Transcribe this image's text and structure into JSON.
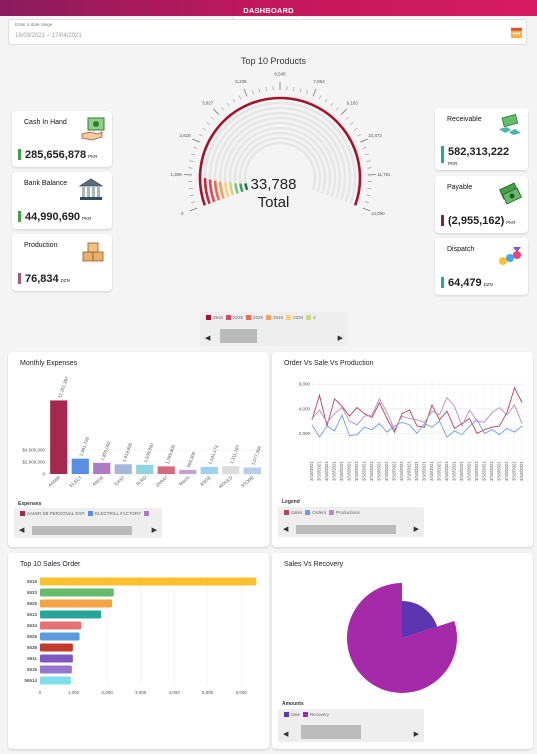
{
  "nav": {
    "tab_label": "DASHBOARD"
  },
  "date_range": {
    "label": "Enter a date range",
    "value": "18/03/2021 – 17/04/2021"
  },
  "kpis": {
    "cash_in_hand": {
      "title": "Cash In Hand",
      "value": "285,656,878",
      "unit": "PKR",
      "color": "#43a047"
    },
    "bank_balance": {
      "title": "Bank Balance",
      "value": "44,990,690",
      "unit": "PKR",
      "color": "#43a047"
    },
    "production": {
      "title": "Production",
      "value": "76,834",
      "unit": "DZN",
      "color": "#9c5d7e"
    },
    "receivable": {
      "title": "Receivable",
      "value": "582,313,222",
      "unit": "PKR",
      "color": "#26a69a"
    },
    "payable": {
      "title": "Payable",
      "value": "(2,955,162)",
      "unit": "PKR",
      "color": "#8e1e3a"
    },
    "dispatch": {
      "title": "Dispatch",
      "value": "64,479",
      "unit": "DZN",
      "color": "#26a69a"
    }
  },
  "top_products": {
    "title": "Top 10 Products",
    "total_value": "33,788",
    "total_label": "Total",
    "scale_labels": [
      "0",
      "1,309",
      "2,618",
      "3,927",
      "5,236",
      "6,545",
      "7,854",
      "9,163",
      "10,472",
      "11,781",
      "13,090"
    ],
    "legend": [
      {
        "name": "2915",
        "color": "#a5122a"
      },
      {
        "name": "2225",
        "color": "#e0475f"
      },
      {
        "name": "2225",
        "color": "#f06a4a"
      },
      {
        "name": "2915",
        "color": "#f4a259"
      },
      {
        "name": "2234",
        "color": "#f7d27b"
      },
      {
        "name": "2",
        "color": "#c8dc7e"
      }
    ]
  },
  "monthly_expenses": {
    "title": "Monthly Expenses",
    "legend_title": "Expenses",
    "legend_items": [
      {
        "name": "AAMIR SB PERSONAL EXP.",
        "color": "#a5284f"
      },
      {
        "name": "ELECTRILL FACTORY",
        "color": "#5a8ee0"
      },
      {
        "name": "",
        "color": "#b07ac0"
      }
    ]
  },
  "order_sale_production": {
    "title": "Order Vs Sale Vs Production",
    "legend_title": "Legend",
    "legend_items": [
      {
        "name": "Sales",
        "color": "#b2445a"
      },
      {
        "name": "Orders",
        "color": "#6f9be3"
      },
      {
        "name": "Productions",
        "color": "#b88ac6"
      }
    ]
  },
  "top_sales_order": {
    "title": "Top 10 Sales Order"
  },
  "sales_recovery": {
    "title": "Sales Vs Recovery",
    "legend_title": "Amounts",
    "legend_items": [
      {
        "name": "Sale",
        "color": "#5e35b1"
      },
      {
        "name": "Recovery",
        "color": "#a42aaa"
      }
    ]
  },
  "chart_data": [
    {
      "type": "bar",
      "title": "Monthly Expenses",
      "categories": [
        "AAMIR",
        "ELECT",
        "ANGE",
        "CAST",
        "ALRO",
        "ZARAT",
        "Machi",
        "ANGE",
        "MOULD",
        "STORE"
      ],
      "values": [
        12261397,
        2561728,
        1855000,
        1619800,
        1539800,
        1269900,
        693300,
        1183173,
        1311187,
        1077394
      ],
      "value_labels": [
        "12,261,397",
        "2,561,728",
        "1,855,000",
        "1,619,800",
        "1,539,800",
        "1,269,900",
        "693,300",
        "1,183,173",
        "1,311,187",
        "1,077,394"
      ],
      "colors": [
        "#a5284f",
        "#5a8ee0",
        "#b07ac0",
        "#a6b8d8",
        "#8fd5e0",
        "#d46a7e",
        "#c6a1d4",
        "#9ed0f0",
        "#dcdcdc",
        "#b3cfe9"
      ],
      "ytick_labels": [
        "0",
        "$2,000,000",
        "$4,000,000"
      ],
      "ylim": [
        0,
        14000000
      ]
    },
    {
      "type": "line",
      "title": "Order Vs Sale Vs Production",
      "ytick_labels": [
        "2,000",
        "4,000",
        "6,000"
      ],
      "ylim": [
        0,
        6500
      ],
      "x_tick_label": "3/18/2021",
      "series": [
        {
          "name": "Sales",
          "values": [
            3100,
            5100,
            2600,
            4800,
            4200,
            3400,
            4100,
            3600,
            3300,
            4500,
            3200,
            2100,
            3600,
            3900,
            2600,
            2500,
            4300,
            3100,
            3800,
            2400,
            2800,
            3200,
            2000,
            2300,
            2500,
            2600,
            3700,
            5700,
            4500
          ]
        },
        {
          "name": "Orders",
          "values": [
            2700,
            1700,
            2600,
            2200,
            3500,
            1800,
            1900,
            2500,
            2300,
            2800,
            2100,
            2600,
            2900,
            2700,
            2000,
            2800,
            2500,
            3000,
            1700,
            2200,
            1900,
            2600,
            3100,
            2000,
            2300,
            1900,
            2400,
            2100,
            2600
          ]
        },
        {
          "name": "Productions",
          "values": [
            3200,
            3900,
            2900,
            3600,
            4100,
            3000,
            2700,
            3400,
            3500,
            4800,
            3700,
            2300,
            3400,
            3200,
            3100,
            2900,
            3800,
            3500,
            4900,
            4200,
            2600,
            3900,
            3000,
            2900,
            3700,
            4100,
            3500,
            4300,
            2800
          ]
        }
      ]
    },
    {
      "type": "bar",
      "title": "Top 10 Sales Order",
      "orientation": "horizontal",
      "categories": [
        "5515",
        "5533",
        "5525",
        "5513",
        "5534",
        "5526",
        "5538",
        "5511",
        "5516",
        "55514"
      ],
      "values": [
        6450,
        2200,
        2150,
        1820,
        1230,
        1180,
        980,
        980,
        950,
        920
      ],
      "colors": [
        "#fbc02d",
        "#66bb6a",
        "#f4a542",
        "#26a69a",
        "#e57373",
        "#5a9be0",
        "#c0392b",
        "#7e57c2",
        "#9575cd",
        "#80deea"
      ],
      "xtick_labels": [
        "0",
        "1,000",
        "2,000",
        "3,000",
        "4,000",
        "5,000",
        "6,000"
      ],
      "xlim": [
        0,
        6500
      ]
    },
    {
      "type": "pie",
      "title": "Sales Vs Recovery",
      "labels": [
        "Sale",
        "Recovery"
      ],
      "values": [
        20,
        80
      ],
      "colors": [
        "#5e35b1",
        "#a42aaa"
      ]
    }
  ]
}
